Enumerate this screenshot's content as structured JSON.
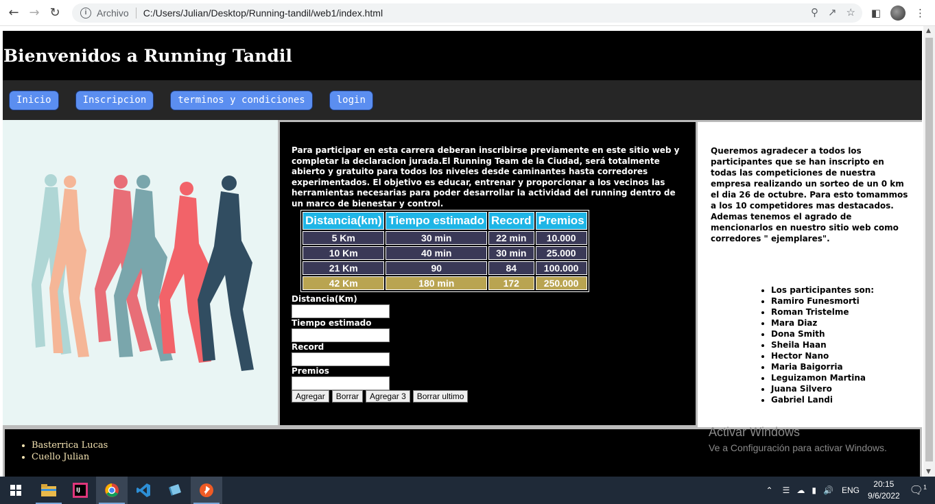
{
  "browser": {
    "archivo_label": "Archivo",
    "url": "C:/Users/Julian/Desktop/Running-tandil/web1/index.html"
  },
  "site": {
    "title": "Bienvenidos a Running Tandil",
    "nav": [
      "Inicio",
      "Inscripcion",
      "terminos y condiciones",
      "login"
    ]
  },
  "middle": {
    "intro": "Para participar en esta carrera deberan inscribirse previamente en este sitio web y completar la declaracion jurada.El Running Team de la Ciudad, será totalmente abierto y gratuito para todos los niveles desde caminantes hasta corredores experimentados. El objetivo es educar, entrenar y proporcionar a los vecinos las herramientas necesarias para poder desarrollar la actividad del running dentro de un marco de bienestar y control.",
    "table": {
      "headers": [
        "Distancia(km)",
        "Tiempo estimado",
        "Record",
        "Premios"
      ],
      "rows": [
        [
          "5 Km",
          "30 min",
          "22 min",
          "10.000"
        ],
        [
          "10 Km",
          "40 min",
          "30 min",
          "25.000"
        ],
        [
          "21 Km",
          "90",
          "84",
          "100.000"
        ],
        [
          "42 Km",
          "180 min",
          "172",
          "250.000"
        ]
      ]
    },
    "form": {
      "labels": [
        "Distancia(Km)",
        "Tiempo estimado",
        "Record",
        "Premios"
      ],
      "buttons": [
        "Agregar",
        "Borrar",
        "Agregar 3",
        "Borrar ultimo"
      ]
    }
  },
  "right": {
    "text": "Queremos agradecer a todos los participantes que se han inscripto en todas las competiciones de nuestra empresa realizando un sorteo de un 0 km el dia 26 de octubre. Para esto tomammos a los 10 competidores mas destacados. Ademas tenemos el agrado de mencionarlos en nuestro sitio web como corredores \" ejemplares\".",
    "participants": [
      "Los participantes son:",
      "Ramiro Funesmorti",
      "Roman Tristelme",
      "Mara Diaz",
      "Dona Smith",
      "Sheila Haan",
      "Hector Nano",
      "Maria Baigorria",
      "Leguizamon Martina",
      "Juana Silvero",
      "Gabriel Landi"
    ]
  },
  "footer": {
    "authors": [
      "Basterrica Lucas",
      "Cuello Julian"
    ]
  },
  "watermark": {
    "line1": "Activar Windows",
    "line2": "Ve a Configuración para activar Windows."
  },
  "taskbar": {
    "language": "ENG",
    "time": "20:15",
    "date": "9/6/2022",
    "notifications": "1"
  }
}
